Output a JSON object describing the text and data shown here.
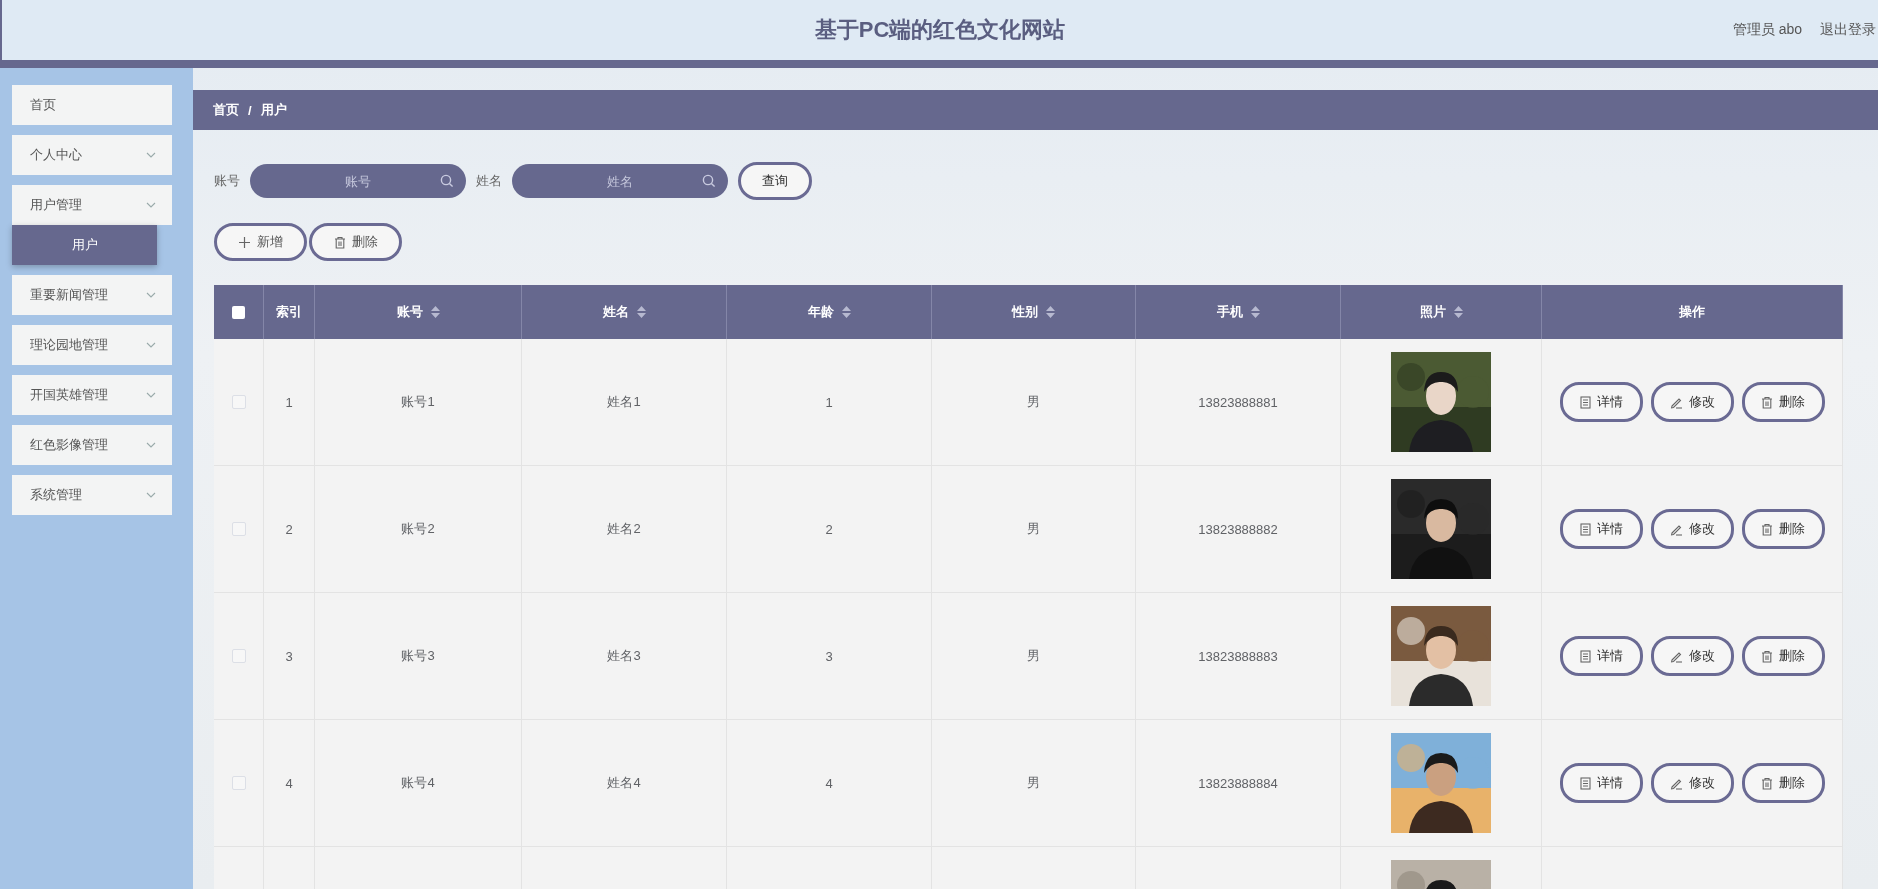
{
  "header": {
    "title": "基于PC端的红色文化网站",
    "user": "管理员 abo",
    "logout": "退出登录"
  },
  "sidebar": {
    "items": [
      {
        "label": "首页",
        "expandable": false
      },
      {
        "label": "个人中心",
        "expandable": true,
        "expanded": false
      },
      {
        "label": "用户管理",
        "expandable": true,
        "expanded": true,
        "children": [
          {
            "label": "用户",
            "selected": true
          }
        ]
      },
      {
        "label": "重要新闻管理",
        "expandable": true,
        "expanded": false
      },
      {
        "label": "理论园地管理",
        "expandable": true,
        "expanded": false
      },
      {
        "label": "开国英雄管理",
        "expandable": true,
        "expanded": false
      },
      {
        "label": "红色影像管理",
        "expandable": true,
        "expanded": false
      },
      {
        "label": "系统管理",
        "expandable": true,
        "expanded": false
      }
    ]
  },
  "breadcrumb": {
    "items": [
      "首页",
      "用户"
    ],
    "separator": "/"
  },
  "search": {
    "fields": [
      {
        "label": "账号",
        "placeholder": "账号"
      },
      {
        "label": "姓名",
        "placeholder": "姓名"
      }
    ],
    "button": "查询"
  },
  "actions": [
    {
      "kind": "add",
      "label": "新增"
    },
    {
      "kind": "delete",
      "label": "删除"
    }
  ],
  "table": {
    "select_all": {
      "checked": false
    },
    "columns": [
      {
        "label": "索引",
        "sortable": false
      },
      {
        "label": "账号",
        "sortable": true
      },
      {
        "label": "姓名",
        "sortable": true
      },
      {
        "label": "年龄",
        "sortable": true
      },
      {
        "label": "性别",
        "sortable": true
      },
      {
        "label": "手机",
        "sortable": true
      },
      {
        "label": "照片",
        "sortable": true
      },
      {
        "label": "操作",
        "sortable": false
      }
    ],
    "rows": [
      {
        "checked": false,
        "cells": [
          "1",
          "账号1",
          "姓名1",
          "1",
          "男",
          "13823888881"
        ],
        "photo": {
          "kind": "picture"
        },
        "actions": [
          {
            "kind": "detail",
            "label": "详情"
          },
          {
            "kind": "edit",
            "label": "修改"
          },
          {
            "kind": "delete",
            "label": "删除"
          }
        ]
      },
      {
        "checked": false,
        "cells": [
          "2",
          "账号2",
          "姓名2",
          "2",
          "男",
          "13823888882"
        ],
        "photo": {
          "kind": "picture"
        },
        "actions": [
          {
            "kind": "detail",
            "label": "详情"
          },
          {
            "kind": "edit",
            "label": "修改"
          },
          {
            "kind": "delete",
            "label": "删除"
          }
        ]
      },
      {
        "checked": false,
        "cells": [
          "3",
          "账号3",
          "姓名3",
          "3",
          "男",
          "13823888883"
        ],
        "photo": {
          "kind": "picture"
        },
        "actions": [
          {
            "kind": "detail",
            "label": "详情"
          },
          {
            "kind": "edit",
            "label": "修改"
          },
          {
            "kind": "delete",
            "label": "删除"
          }
        ]
      },
      {
        "checked": false,
        "cells": [
          "4",
          "账号4",
          "姓名4",
          "4",
          "男",
          "13823888884"
        ],
        "photo": {
          "kind": "picture"
        },
        "actions": [
          {
            "kind": "detail",
            "label": "详情"
          },
          {
            "kind": "edit",
            "label": "修改"
          },
          {
            "kind": "delete",
            "label": "删除"
          }
        ]
      },
      {
        "photo": {
          "kind": "picture"
        }
      }
    ]
  }
}
